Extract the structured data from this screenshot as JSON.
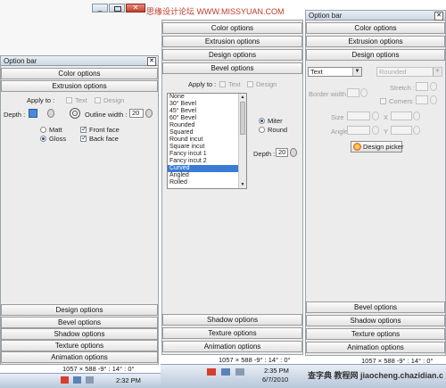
{
  "top_strip": {
    "watermark_top": "思缘设计论坛 WWW.MISSYUAN.COM"
  },
  "left_panel": {
    "title": "Option bar",
    "sections_top": [
      "Color options",
      "Extrusion options"
    ],
    "apply_to_label": "Apply to :",
    "apply_text": "Text",
    "apply_design": "Design",
    "depth_label": "Depth :",
    "outline_width_label": "Outline width :",
    "outline_width_value": "20",
    "matt_label": "Matt",
    "gloss_label": "Gloss",
    "front_face_label": "Front face",
    "back_face_label": "Back face",
    "sections_bottom": [
      "Design options",
      "Bevel options",
      "Shadow options",
      "Texture options",
      "Animation options"
    ],
    "status": "1057 × 588  -9° : 14° : 0°",
    "clock": "2:32 PM"
  },
  "middle_panel": {
    "sections_top": [
      "Color options",
      "Extrusion options",
      "Design options",
      "Bevel options"
    ],
    "apply_to_label": "Apply to :",
    "apply_text": "Text",
    "apply_design": "Design",
    "bevel_list": [
      "None",
      "30° Bevel",
      "45° Bevel",
      "60° Bevel",
      "Rounded",
      "Squared",
      "Round incut",
      "Square incut",
      "Fancy incut 1",
      "Fancy incut 2",
      "Curved",
      "Angled",
      "Rolled"
    ],
    "bevel_selected": "Curved",
    "miter_label": "Miter",
    "round_label": "Round",
    "depth_label": "Depth :",
    "depth_value": "20",
    "sections_bottom": [
      "Shadow options",
      "Texture options",
      "Animation options"
    ],
    "status": "1057 × 588  -9° : 14° : 0°",
    "clock": "2:35 PM",
    "date": "6/7/2010"
  },
  "right_panel": {
    "title": "Option bar",
    "sections_top": [
      "Color options",
      "Extrusion options",
      "Design options"
    ],
    "type_combo": "Text",
    "shape_combo": "Rounded",
    "border_width_label": "Border width :",
    "stretch_label": "Stretch :",
    "corners_label": "Corners",
    "size_label": "Size",
    "angle_label": "Angle",
    "x_label": "X",
    "y_label": "Y",
    "design_picker_label": "Design picker",
    "sections_bottom": [
      "Bevel options",
      "Shadow options",
      "Texture options",
      "Animation options"
    ],
    "status": "1057 × 588  -9° : 14° : 0°"
  },
  "watermark_bottom": "查字典 教程网 jiaocheng.chazidian.com"
}
